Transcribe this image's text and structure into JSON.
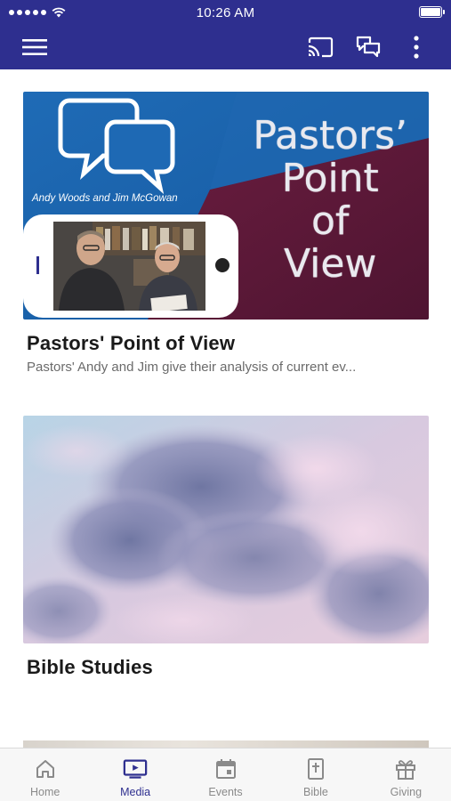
{
  "status_bar": {
    "time": "10:26 AM"
  },
  "colors": {
    "brand": "#2e2f8f",
    "tab_inactive": "#8a8a8a"
  },
  "app_bar": {
    "icons": [
      "menu-icon",
      "cast-icon",
      "chat-icon",
      "more-vertical-icon"
    ]
  },
  "cards": [
    {
      "title": "Pastors' Point of View",
      "subtitle": "Pastors' Andy and Jim give their analysis of current ev...",
      "banner": {
        "title_line1": "Pastors’",
        "title_line2": "Point",
        "title_line3": "of",
        "title_line4": "View",
        "caption": "Andy Woods and Jim McGowan"
      }
    },
    {
      "title": "Bible Studies"
    }
  ],
  "tabs": [
    {
      "label": "Home",
      "icon": "home-icon",
      "active": false
    },
    {
      "label": "Media",
      "icon": "tv-play-icon",
      "active": true
    },
    {
      "label": "Events",
      "icon": "calendar-icon",
      "active": false
    },
    {
      "label": "Bible",
      "icon": "bible-icon",
      "active": false
    },
    {
      "label": "Giving",
      "icon": "gift-icon",
      "active": false
    }
  ]
}
